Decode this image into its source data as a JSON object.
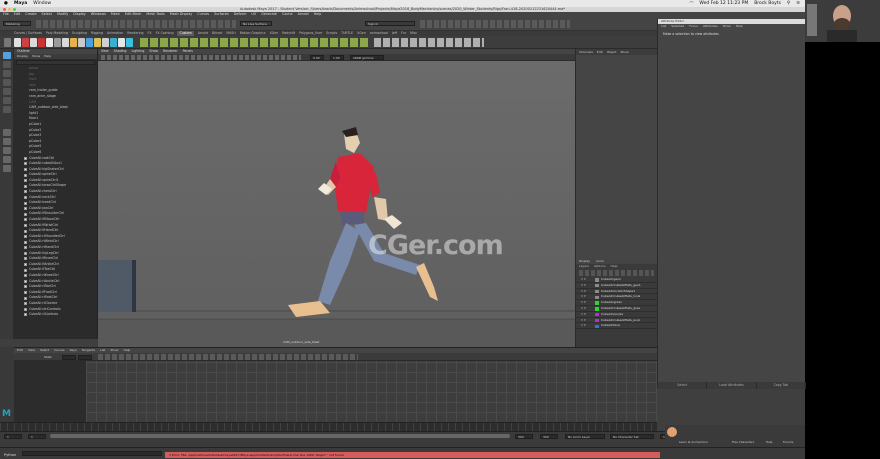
{
  "mac": {
    "apple": "",
    "app_name": "Maya",
    "menu_window": "Window",
    "clock": "Wed Feb 12  11:23 PM",
    "user": "Brock Boyts"
  },
  "window": {
    "title": "Autodesk Maya 2017 - Student Version: /Users/brock/Documents/Animschool/Projects/Maya2016_BodyMechanics/scenes/2020_Winter_Students/Rigs/Fran-418-20200212231620444.ma*"
  },
  "menubar": [
    "File",
    "Edit",
    "Create",
    "Select",
    "Modify",
    "Display",
    "Windows",
    "Mesh",
    "Edit Mesh",
    "Mesh Tools",
    "Mesh Display",
    "Curves",
    "Surfaces",
    "Deform",
    "UV",
    "Generate",
    "Cache",
    "Arnold",
    "Help"
  ],
  "statusline": {
    "menu_set": "Modeling",
    "live_surface": "No Live Surface",
    "sign_in": "Sign In",
    "workspace_label": "Workspace:",
    "workspace_value": "Maya Classic"
  },
  "shelf_tabs": [
    "Curves / Surfaces",
    "Poly Modeling",
    "Sculpting",
    "Rigging",
    "Animation",
    "Rendering",
    "FX",
    "FX Caching",
    "Custom",
    "Arnold",
    "Bifrost",
    "MASH",
    "Motion Graphics",
    "XGen",
    "Redshift",
    "Polygons_User",
    "Scripts",
    "TURTLE",
    "XGen",
    "animschool",
    "Jeff",
    "Fur",
    "Misc"
  ],
  "shelf_active": "Custom",
  "outliner": {
    "title": "Outliner",
    "menu": [
      "Display",
      "Show",
      "Help"
    ],
    "items": [
      {
        "label": "persp",
        "dim": true,
        "check": false
      },
      {
        "label": "top",
        "dim": true,
        "check": false
      },
      {
        "label": "front",
        "dim": true,
        "check": false
      },
      {
        "label": "side",
        "dim": true,
        "check": false
      },
      {
        "label": "cam_trailer_guide",
        "dim": false,
        "check": false
      },
      {
        "label": "cam_anim_stage",
        "dim": false,
        "check": false
      },
      {
        "label": "CAM",
        "dim": true,
        "check": false
      },
      {
        "label": "CAM_outdoor_side_blast",
        "dim": false,
        "check": false
      },
      {
        "label": "light1",
        "dim": false,
        "check": false
      },
      {
        "label": "floor1",
        "dim": false,
        "check": false
      },
      {
        "label": "pCube1",
        "dim": false,
        "check": false
      },
      {
        "label": "pCube2",
        "dim": false,
        "check": false
      },
      {
        "label": "pCube3",
        "dim": false,
        "check": false
      },
      {
        "label": "pCube4",
        "dim": false,
        "check": false
      },
      {
        "label": "pCube5",
        "dim": false,
        "check": false
      },
      {
        "label": "pCube6",
        "dim": false,
        "check": false
      },
      {
        "label": "CubeAll:rootCtrl",
        "dim": false,
        "check": true
      },
      {
        "label": "CubeAll:cubeAllAux1",
        "dim": false,
        "check": true
      },
      {
        "label": "CubeAll:hipShakerCtrl",
        "dim": false,
        "check": true
      },
      {
        "label": "CubeAll:spineCtrl",
        "dim": false,
        "check": true
      },
      {
        "label": "CubeAll:spineCtrl1",
        "dim": false,
        "check": true
      },
      {
        "label": "CubeAll:torsoCtrlShape",
        "dim": false,
        "check": true
      },
      {
        "label": "CubeAll:chestCtrl",
        "dim": false,
        "check": true
      },
      {
        "label": "CubeAll:neckCtrl",
        "dim": false,
        "check": true
      },
      {
        "label": "CubeAll:headCtrl",
        "dim": false,
        "check": true
      },
      {
        "label": "CubeAll:jawCtrl",
        "dim": false,
        "check": true
      },
      {
        "label": "CubeAll:lfShoulderCtrl",
        "dim": false,
        "check": true
      },
      {
        "label": "CubeAll:lfElbowCtrl",
        "dim": false,
        "check": true
      },
      {
        "label": "CubeAll:lfWristCtrl",
        "dim": false,
        "check": true
      },
      {
        "label": "CubeAll:lfHandCtrl",
        "dim": false,
        "check": true
      },
      {
        "label": "CubeAll:rtShoulderCtrl",
        "dim": false,
        "check": true
      },
      {
        "label": "CubeAll:rtWristCtrl",
        "dim": false,
        "check": true
      },
      {
        "label": "CubeAll:rtHandCtrl",
        "dim": false,
        "check": true
      },
      {
        "label": "CubeAll:hipLegCtrl",
        "dim": false,
        "check": true
      },
      {
        "label": "CubeAll:lfKneeCtrl",
        "dim": false,
        "check": true
      },
      {
        "label": "CubeAll:lfAnkleCtrl",
        "dim": false,
        "check": true
      },
      {
        "label": "CubeAll:lfToeCtrl",
        "dim": false,
        "check": true
      },
      {
        "label": "CubeAll:rtKneeCtrl",
        "dim": false,
        "check": true
      },
      {
        "label": "CubeAll:rtAnkleCtrl",
        "dim": false,
        "check": true
      },
      {
        "label": "CubeAll:rtToeCtrl",
        "dim": false,
        "check": true
      },
      {
        "label": "CubeAll:lfFootCtrl",
        "dim": false,
        "check": true
      },
      {
        "label": "CubeAll:rtFootCtrl",
        "dim": false,
        "check": true
      },
      {
        "label": "CubeAll:rtClavicle",
        "dim": false,
        "check": true
      },
      {
        "label": "CubeAll:ctrlControls",
        "dim": false,
        "check": true
      },
      {
        "label": "CubeAll:rtControls",
        "dim": false,
        "check": true
      }
    ]
  },
  "viewport": {
    "menu": [
      "View",
      "Shading",
      "Lighting",
      "Show",
      "Renderer",
      "Panels"
    ],
    "exposure": "0.00",
    "gamma": "1.00",
    "color_space": "sRGB gamma",
    "camera_label": "CAM_outdoor_side_blast",
    "watermark": "CGer.com"
  },
  "channelbox": {
    "menu": [
      "Channels",
      "Edit",
      "Object",
      "Show"
    ]
  },
  "layer_editor": {
    "tabs": [
      "Display",
      "Anim"
    ],
    "sub": [
      "Layers",
      "Options",
      "Help"
    ],
    "layers": [
      {
        "label": "CubeAll:geo1",
        "color": "#8a8a8a"
      },
      {
        "label": "CubeAll:CubeAllHats_geo1",
        "color": "#8a8a8a"
      },
      {
        "label": "CubeAll:locatorShape1",
        "color": "#8a8a8a"
      },
      {
        "label": "CubeAll:CubeAllHats_local",
        "color": "#8a8a8a"
      },
      {
        "label": "CubeAll:green",
        "color": "#2fd22f"
      },
      {
        "label": "CubeAll:CubeAllHats_gree",
        "color": "#2fd22f"
      },
      {
        "label": "CubeAll:purple",
        "color": "#b42fd2"
      },
      {
        "label": "CubeAll:CubeAllHats_purp",
        "color": "#b42fd2"
      },
      {
        "label": "CubeAll:blue",
        "color": "#2f78d2"
      }
    ]
  },
  "attr_editor": {
    "title": "Attribute Editor",
    "menu": [
      "List",
      "Selected",
      "Focus",
      "Attributes",
      "Show",
      "Help"
    ],
    "message": "Make a selection to view attributes",
    "bottom": [
      "Select",
      "Load Attributes",
      "Copy Tab"
    ]
  },
  "graph_editor": {
    "menu": [
      "Edit",
      "View",
      "Select",
      "Curves",
      "Keys",
      "Tangents",
      "List",
      "Show",
      "Help"
    ],
    "stats_label": "Stats"
  },
  "timeline": {
    "start": "1",
    "range_start": "1",
    "range_end": "300",
    "end": "300",
    "current": "1",
    "anim_layer": "No Anim Layer",
    "char_set": "No Character Set",
    "fps": "24 fps"
  },
  "cmdline": {
    "label": "Python",
    "error": "// Error: File: /Applications/Autodesk/maya2017/Maya.app/Contents/scripts/others/.mel line 1999: Object '' not found."
  },
  "dock": {
    "items": [
      "Learn at Animschool",
      "Free Characters",
      "Help",
      "Forums"
    ]
  }
}
